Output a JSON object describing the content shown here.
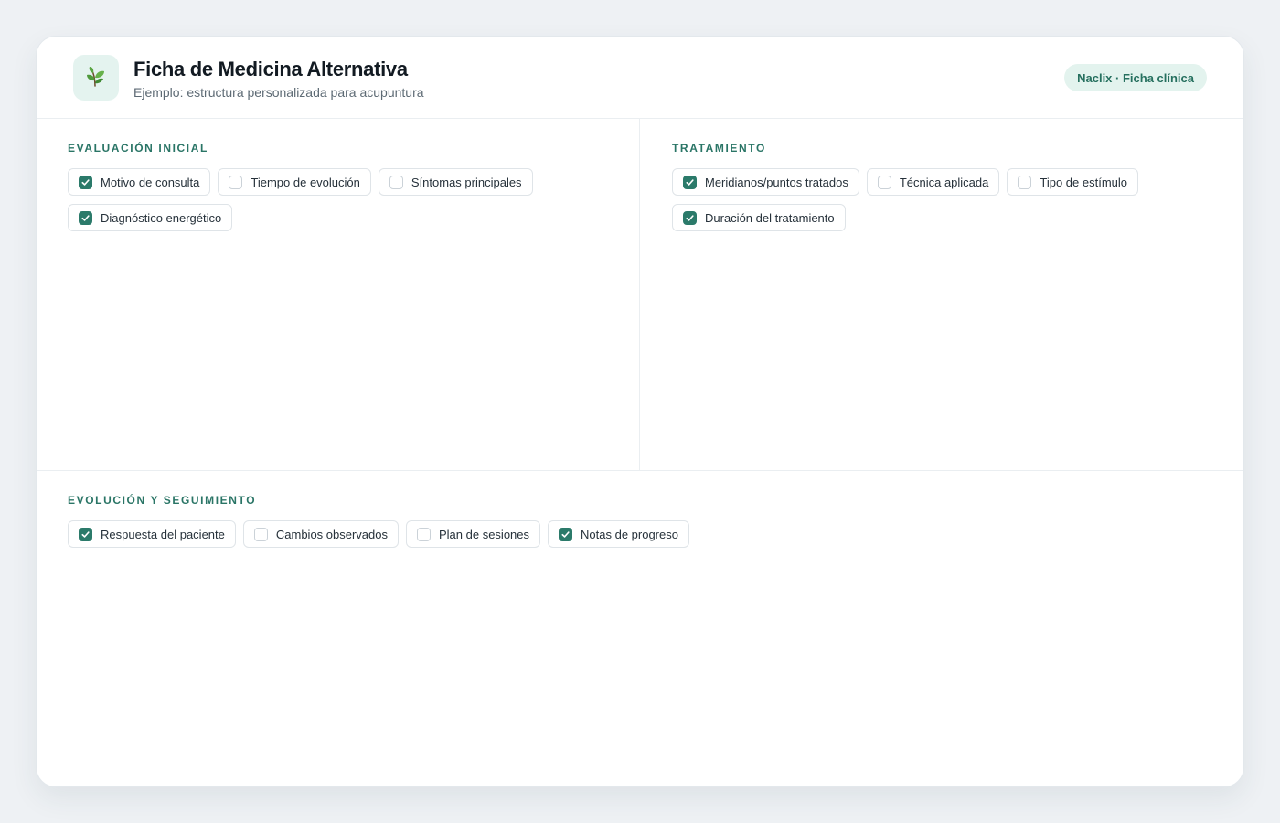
{
  "header": {
    "title": "Ficha de Medicina Alternativa",
    "subtitle": "Ejemplo: estructura personalizada para acupuntura",
    "badge": "Naclix · Ficha clínica",
    "logo_icon": "leaf-icon"
  },
  "colors": {
    "accent": "#2b7a6a",
    "badge_bg": "#e3f3ee",
    "logo_bg": "#e4f3ef"
  },
  "sections": [
    {
      "title": "EVALUACIÓN INICIAL",
      "items": [
        {
          "label": "Motivo de consulta",
          "checked": true
        },
        {
          "label": "Tiempo de evolución",
          "checked": false
        },
        {
          "label": "Síntomas principales",
          "checked": false
        },
        {
          "label": "Diagnóstico energético",
          "checked": true
        }
      ]
    },
    {
      "title": "TRATAMIENTO",
      "items": [
        {
          "label": "Meridianos/puntos tratados",
          "checked": true
        },
        {
          "label": "Técnica aplicada",
          "checked": false
        },
        {
          "label": "Tipo de estímulo",
          "checked": false
        },
        {
          "label": "Duración del tratamiento",
          "checked": true
        }
      ]
    },
    {
      "title": "EVOLUCIÓN Y SEGUIMIENTO",
      "items": [
        {
          "label": "Respuesta del paciente",
          "checked": true
        },
        {
          "label": "Cambios observados",
          "checked": false
        },
        {
          "label": "Plan de sesiones",
          "checked": false
        },
        {
          "label": "Notas de progreso",
          "checked": true
        }
      ]
    }
  ]
}
